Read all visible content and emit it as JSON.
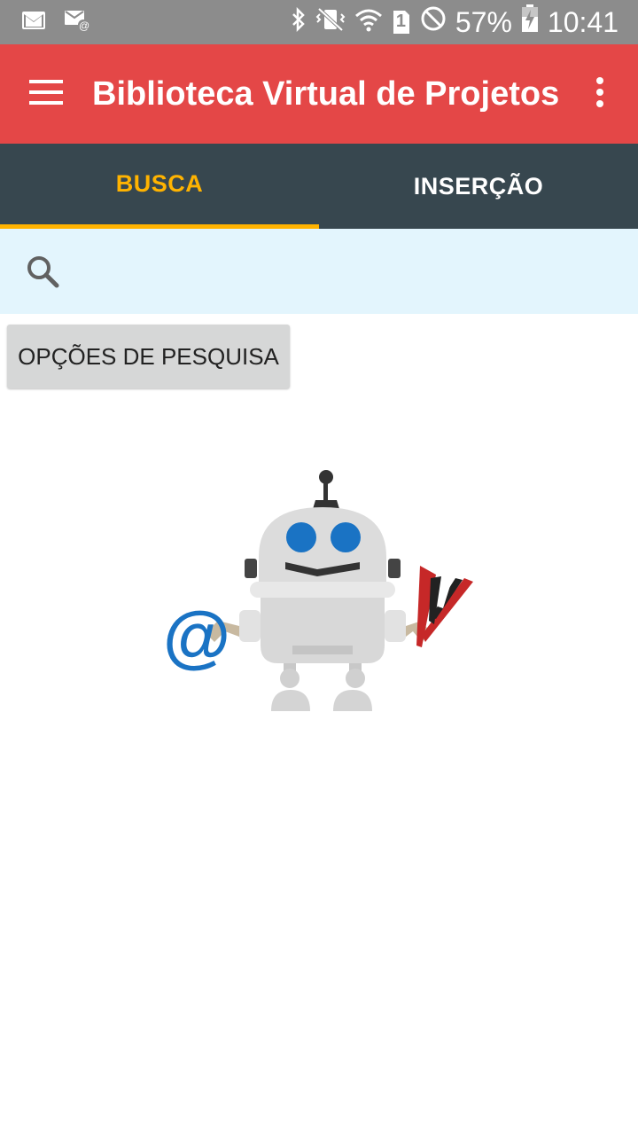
{
  "status_bar": {
    "battery_percent": "57%",
    "time": "10:41",
    "sim_slot": "1",
    "icons": [
      "gmail-icon",
      "email-icon",
      "bluetooth-icon",
      "vibrate-icon",
      "wifi-icon",
      "sim-icon",
      "do-not-disturb-icon",
      "battery-charging-icon"
    ]
  },
  "app_bar": {
    "title": "Biblioteca Virtual de Projetos"
  },
  "tabs": [
    {
      "label": "BUSCA",
      "active": true
    },
    {
      "label": "INSERÇÃO",
      "active": false
    }
  ],
  "search": {
    "value": "",
    "placeholder": ""
  },
  "options_button": {
    "label": "OPÇÕES DE PESQUISA"
  },
  "colors": {
    "app_bar": "#e44747",
    "tab_bar": "#37474f",
    "tab_active": "#ffb300",
    "search_bg": "#e3f5fd",
    "status_bar": "#8c8c8c"
  }
}
